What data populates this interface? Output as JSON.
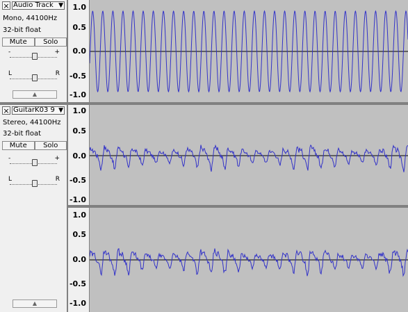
{
  "tracks": [
    {
      "name": "Audio Track",
      "info1": "Mono, 44100Hz",
      "info2": "32-bit float",
      "mute": "Mute",
      "solo": "Solo",
      "gain_minus": "-",
      "gain_plus": "+",
      "pan_left": "L",
      "pan_right": "R",
      "ruler": [
        "1.0",
        "0.5",
        "0.0",
        "-0.5",
        "-1.0"
      ]
    },
    {
      "name": "GuitarK03 9",
      "info1": "Stereo, 44100Hz",
      "info2": "32-bit float",
      "mute": "Mute",
      "solo": "Solo",
      "gain_minus": "-",
      "gain_plus": "+",
      "pan_left": "L",
      "pan_right": "R",
      "ruler_left": [
        "1.0",
        "0.5",
        "0.0",
        "-0.5",
        "-1.0"
      ],
      "ruler_right": [
        "1.0",
        "0.5",
        "0.0",
        "-0.5",
        "-1.0"
      ]
    }
  ],
  "icons": {
    "close": "×",
    "dropdown": "▼",
    "collapse": "▲"
  },
  "colors": {
    "waveform": "#3232c8",
    "background": "#c0c0c0",
    "zero_line": "#000000"
  }
}
